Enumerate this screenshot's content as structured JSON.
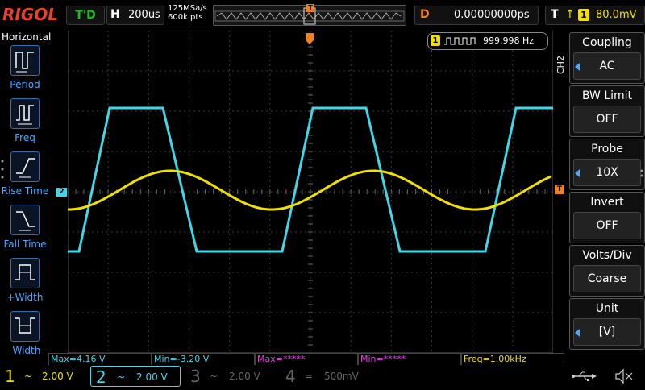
{
  "header": {
    "logo": "RIGOL",
    "run_status": "T'D",
    "timebase_key": "H",
    "timebase_value": "200us",
    "sample_rate": "125MSa/s",
    "memory_depth": "600k pts",
    "delay_key": "D",
    "delay_value": "0.00000000ps",
    "trigger_key": "T",
    "trigger_source": "1",
    "trigger_level": "80.0mV"
  },
  "left_menu": {
    "title": "Horizontal",
    "items": [
      {
        "label": "Period",
        "icon": "period-icon"
      },
      {
        "label": "Freq",
        "icon": "freq-icon"
      },
      {
        "label": "Rise Time",
        "icon": "rise-time-icon"
      },
      {
        "label": "Fall Time",
        "icon": "fall-time-icon"
      },
      {
        "label": "+Width",
        "icon": "pos-width-icon"
      },
      {
        "label": "-Width",
        "icon": "neg-width-icon"
      }
    ]
  },
  "frequency_counter": {
    "channel": "1",
    "value": "999.998 Hz"
  },
  "right_menu": {
    "channel_tag": "CH2",
    "items": [
      {
        "title": "Coupling",
        "value": "AC",
        "has_arrow": true
      },
      {
        "title": "BW Limit",
        "value": "OFF",
        "has_arrow": false
      },
      {
        "title": "Probe",
        "value": "10X",
        "has_arrow": true
      },
      {
        "title": "Invert",
        "value": "OFF",
        "has_arrow": false
      },
      {
        "title": "Volts/Div",
        "value": "Coarse",
        "has_arrow": false
      },
      {
        "title": "Unit",
        "value": "[V]",
        "has_arrow": true
      }
    ]
  },
  "markers": {
    "ch2_level": "2",
    "trigger_level": "T"
  },
  "measurements": [
    {
      "text": "Max=4.16 V",
      "color": "#40d8e8"
    },
    {
      "text": "Min=-3.20 V",
      "color": "#40d8e8"
    },
    {
      "text": "Max=*****",
      "color": "#e040e0"
    },
    {
      "text": "Min=*****",
      "color": "#e040e0"
    },
    {
      "text": "Freq=1.00kHz",
      "color": "#f0e000"
    }
  ],
  "channels": [
    {
      "number": "1",
      "coupling": "~",
      "scale": "2.00 V",
      "color": "#f0e000",
      "active": false
    },
    {
      "number": "2",
      "coupling": "~",
      "scale": "2.00 V",
      "color": "#40d8e8",
      "active": true
    },
    {
      "number": "3",
      "coupling": "~",
      "scale": "2.00 V",
      "color": "#666666",
      "active": false
    },
    {
      "number": "4",
      "coupling": "=",
      "scale": "500mV",
      "color": "#666666",
      "active": false
    }
  ],
  "status_icons": [
    "usb-icon",
    "speaker-mute-icon"
  ]
}
